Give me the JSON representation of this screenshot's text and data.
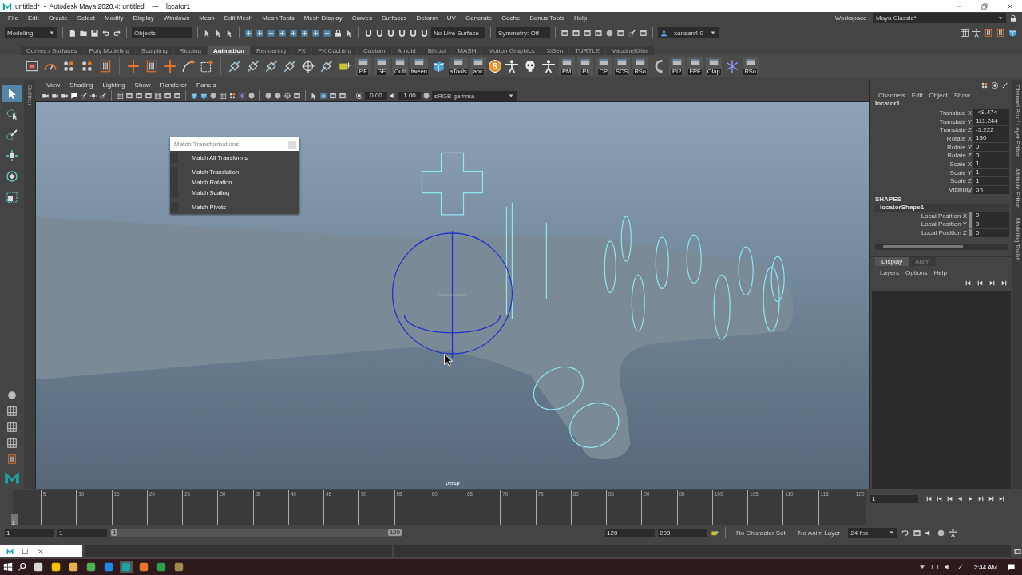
{
  "window": {
    "title": "untitled*  -  Autodesk Maya 2020.4: untitled    ---    locator1"
  },
  "menu_bar": [
    "File",
    "Edit",
    "Create",
    "Select",
    "Modify",
    "Display",
    "Windows",
    "Mesh",
    "Edit Mesh",
    "Mesh Tools",
    "Mesh Display",
    "Curves",
    "Surfaces",
    "Deform",
    "UV",
    "Generate",
    "Cache",
    "Bonus Tools",
    "Help"
  ],
  "workspace": {
    "label": "Workspace :",
    "value": "Maya Classic*"
  },
  "status_line": {
    "mode": "Modeling",
    "selection_mode": "Objects",
    "live_surface": "No Live Surface",
    "symmetry": "Symmetry: Off",
    "user": "xansan4.0"
  },
  "shelf_tabs": [
    {
      "label": "Curves / Surfaces",
      "selected": false
    },
    {
      "label": "Poly Modeling",
      "selected": false
    },
    {
      "label": "Sculpting",
      "selected": false
    },
    {
      "label": "Rigging",
      "selected": false
    },
    {
      "label": "Animation",
      "selected": true
    },
    {
      "label": "Rendering",
      "selected": false
    },
    {
      "label": "FX",
      "selected": false
    },
    {
      "label": "FX Caching",
      "selected": false
    },
    {
      "label": "Custom",
      "selected": false
    },
    {
      "label": "Arnold",
      "selected": false
    },
    {
      "label": "Bifrost",
      "selected": false
    },
    {
      "label": "MASH",
      "selected": false
    },
    {
      "label": "Motion Graphics",
      "selected": false
    },
    {
      "label": "XGen",
      "selected": false
    },
    {
      "label": "TURTLE",
      "selected": false
    },
    {
      "label": "VaccineKiller",
      "selected": false
    }
  ],
  "shelf": [
    {
      "kind": "film"
    },
    {
      "kind": "gauge"
    },
    {
      "kind": "dots"
    },
    {
      "kind": "dots"
    },
    {
      "kind": "bars"
    },
    {
      "kind": "sep"
    },
    {
      "kind": "cross"
    },
    {
      "kind": "bars"
    },
    {
      "kind": "cross"
    },
    {
      "kind": "curve"
    },
    {
      "kind": "box"
    },
    {
      "kind": "sep"
    },
    {
      "kind": "chain"
    },
    {
      "kind": "chain"
    },
    {
      "kind": "chain"
    },
    {
      "kind": "chain"
    },
    {
      "kind": "target"
    },
    {
      "kind": "chain"
    },
    {
      "kind": "key"
    },
    {
      "kind": "labeled",
      "label": "RE"
    },
    {
      "kind": "labeled",
      "label": "GE"
    },
    {
      "kind": "labeled",
      "label": "Outl"
    },
    {
      "kind": "labeled",
      "label": "tween"
    },
    {
      "kind": "cube"
    },
    {
      "kind": "labeled",
      "label": "aTools"
    },
    {
      "kind": "labeled",
      "label": "abc"
    },
    {
      "kind": "badge",
      "label": "5"
    },
    {
      "kind": "figure"
    },
    {
      "kind": "skull"
    },
    {
      "kind": "figure"
    },
    {
      "kind": "labeled",
      "label": "PM"
    },
    {
      "kind": "labeled",
      "label": "PI"
    },
    {
      "kind": "labeled",
      "label": "CP"
    },
    {
      "kind": "labeled",
      "label": "SCS"
    },
    {
      "kind": "labeled",
      "label": "RSo"
    },
    {
      "kind": "hook"
    },
    {
      "kind": "labeled",
      "label": "PI2"
    },
    {
      "kind": "labeled",
      "label": "FPE"
    },
    {
      "kind": "labeled",
      "label": "Olap"
    },
    {
      "kind": "star"
    },
    {
      "kind": "labeled",
      "label": "RSo"
    }
  ],
  "toolbox": [
    {
      "kind": "arrow",
      "selected": true
    },
    {
      "kind": "lasso",
      "selected": false
    },
    {
      "kind": "brush",
      "selected": false
    },
    {
      "kind": "move",
      "selected": false
    },
    {
      "kind": "rotate",
      "selected": false
    },
    {
      "kind": "scale",
      "selected": false
    }
  ],
  "viewport": {
    "outliner_tab": "Outliner",
    "menus": [
      "View",
      "Shading",
      "Lighting",
      "Show",
      "Renderer",
      "Panels"
    ],
    "exposure": "0.00",
    "gamma": "1.00",
    "color_space": "sRGB gamma",
    "camera": "persp"
  },
  "popup": {
    "title": "Match Transformations",
    "groups": [
      [
        "Match All Transforms"
      ],
      [
        "Match Translation",
        "Match Rotation",
        "Match Scaling"
      ],
      [
        "Match Pivots"
      ]
    ]
  },
  "channel_box": {
    "menus": [
      "Channels",
      "Edit",
      "Object",
      "Show"
    ],
    "object": "locator1",
    "channels": [
      {
        "name": "Translate X",
        "value": "-48.474"
      },
      {
        "name": "Translate Y",
        "value": "111.244"
      },
      {
        "name": "Translate Z",
        "value": "-3.222"
      },
      {
        "name": "Rotate X",
        "value": "180"
      },
      {
        "name": "Rotate Y",
        "value": "0"
      },
      {
        "name": "Rotate Z",
        "value": "0"
      },
      {
        "name": "Scale X",
        "value": "1"
      },
      {
        "name": "Scale Y",
        "value": "1"
      },
      {
        "name": "Scale Z",
        "value": "1"
      },
      {
        "name": "Visibility",
        "value": "on"
      }
    ],
    "shapes_heading": "SHAPES",
    "shape": "locatorShape1",
    "shape_channels": [
      {
        "name": "Local Position X",
        "value": "0"
      },
      {
        "name": "Local Position Y",
        "value": "0"
      },
      {
        "name": "Local Position Z",
        "value": "0"
      }
    ]
  },
  "layer_editor": {
    "tabs": [
      {
        "label": "Display",
        "selected": true
      },
      {
        "label": "Anim",
        "selected": false
      }
    ],
    "menus": [
      "Layers",
      "Options",
      "Help"
    ]
  },
  "side_tabs": [
    "Channel Box / Layer Editor",
    "Attribute Editor",
    "Modeling Toolkit"
  ],
  "timeline": {
    "ticks": [
      "5",
      "10",
      "15",
      "20",
      "25",
      "30",
      "35",
      "40",
      "45",
      "50",
      "55",
      "60",
      "65",
      "70",
      "75",
      "80",
      "85",
      "90",
      "95",
      "100",
      "105",
      "110",
      "115",
      "120"
    ],
    "current_frame": "1",
    "level": 0,
    "frame_field": "1"
  },
  "range": {
    "start": "1",
    "playback_start": "1",
    "slider_start": "1",
    "slider_end": "120",
    "level": 1,
    "playback_end": "120",
    "end": "200",
    "character_set": "No Character Set",
    "anim_layer": "No Anim Layer",
    "fps": "24 fps"
  },
  "taskbar": {
    "time": "2:44 AM"
  }
}
